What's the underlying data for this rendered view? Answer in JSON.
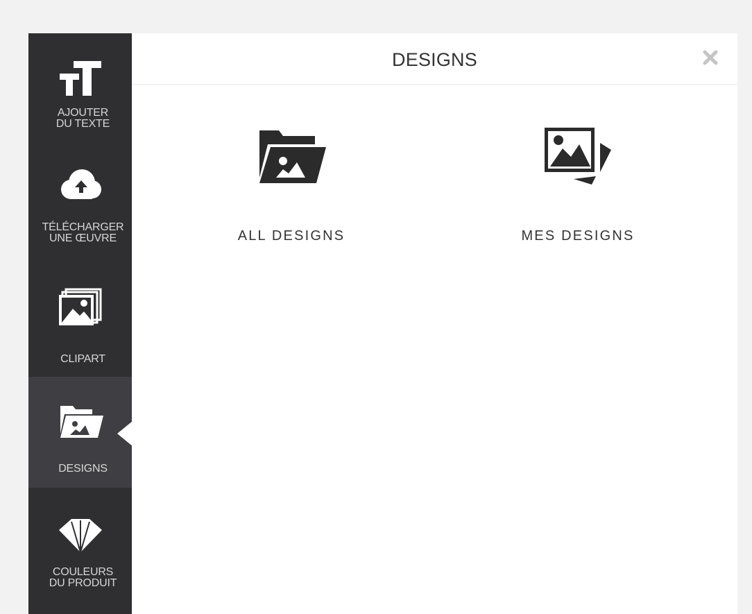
{
  "sidebar": {
    "items": [
      {
        "label": "AJOUTER\nDU TEXTE",
        "icon": "text-size-icon",
        "active": false
      },
      {
        "label": "TÉLÉCHARGER\nUNE ŒUVRE",
        "icon": "cloud-upload-icon",
        "active": false
      },
      {
        "label": "CLIPART",
        "icon": "clipart-images-icon",
        "active": false
      },
      {
        "label": "DESIGNS",
        "icon": "folder-image-icon",
        "active": true
      },
      {
        "label": "COULEURS\nDU PRODUIT",
        "icon": "color-swatches-icon",
        "active": false
      }
    ]
  },
  "panel": {
    "title": "DESIGNS",
    "close_icon": "close-icon",
    "options": [
      {
        "label": "ALL DESIGNS",
        "icon": "folder-image-icon"
      },
      {
        "label": "MES DESIGNS",
        "icon": "my-images-icon"
      }
    ]
  },
  "colors": {
    "sidebar_bg": "#2f2f31",
    "sidebar_active_bg": "#3f3f43",
    "sidebar_text": "#d6d6d6",
    "page_bg": "#f2f2f2",
    "panel_bg": "#ffffff",
    "text": "#333333"
  }
}
